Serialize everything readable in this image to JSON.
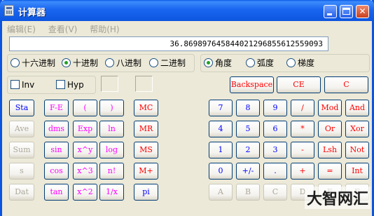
{
  "title": "计算器",
  "menu": [
    "编辑(E)",
    "查看(V)",
    "帮助(H)"
  ],
  "display": {
    "value": "36.869897645844021296855612559093"
  },
  "base_radios": [
    {
      "label": "十六进制",
      "selected": false
    },
    {
      "label": "十进制",
      "selected": true
    },
    {
      "label": "八进制",
      "selected": false
    },
    {
      "label": "二进制",
      "selected": false
    }
  ],
  "angle_radios": [
    {
      "label": "角度",
      "selected": true
    },
    {
      "label": "弧度",
      "selected": false
    },
    {
      "label": "梯度",
      "selected": false
    }
  ],
  "checks": [
    {
      "label": "Inv",
      "checked": false
    },
    {
      "label": "Hyp",
      "checked": false
    }
  ],
  "buttons": {
    "backspace": "Backspace",
    "ce": "CE",
    "c": "C",
    "sta": "Sta",
    "fe": "F-E",
    "lparen": "(",
    "rparen": ")",
    "mc": "MC",
    "ave": "Ave",
    "dms": "dms",
    "exp": "Exp",
    "ln": "ln",
    "mr": "MR",
    "sum": "Sum",
    "sin": "sin",
    "xy": "x^y",
    "log": "log",
    "ms": "MS",
    "s": "s",
    "cos": "cos",
    "x3": "x^3",
    "nfact": "n!",
    "mplus": "M+",
    "dat": "Dat",
    "tan": "tan",
    "x2": "x^2",
    "inv": "1/x",
    "pi": "pi",
    "d7": "7",
    "d8": "8",
    "d9": "9",
    "div": "/",
    "mod": "Mod",
    "and": "And",
    "d4": "4",
    "d5": "5",
    "d6": "6",
    "mul": "*",
    "or": "Or",
    "xor": "Xor",
    "d1": "1",
    "d2": "2",
    "d3": "3",
    "sub": "-",
    "lsh": "Lsh",
    "not": "Not",
    "d0": "0",
    "sign": "+/-",
    "dot": ".",
    "add": "+",
    "eq": "=",
    "int": "Int",
    "ha": "A",
    "hb": "B",
    "hc": "C",
    "hd": "D",
    "he": "E",
    "hf": "F"
  },
  "watermark": "大智网汇"
}
